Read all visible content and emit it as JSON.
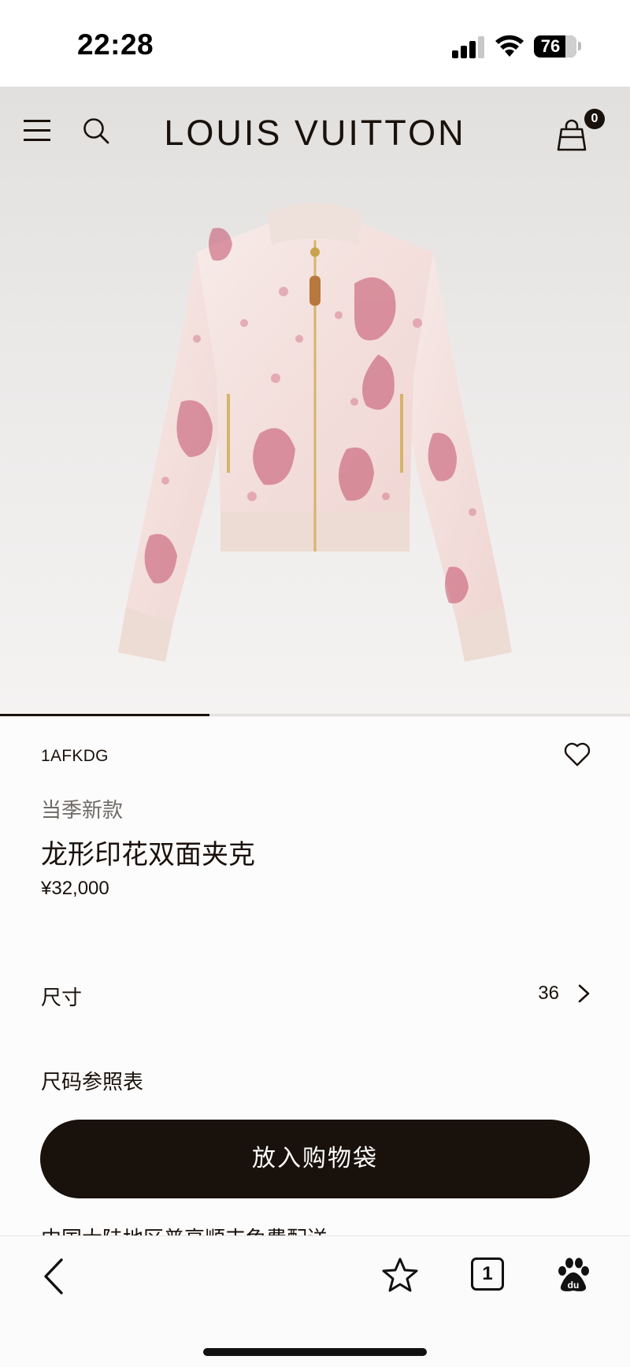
{
  "status_bar": {
    "time": "22:28",
    "battery": "76"
  },
  "header": {
    "brand": "LOUIS VUITTON",
    "bag_count": "0",
    "icons": [
      "menu-icon",
      "search-icon",
      "shopping-bag-icon"
    ]
  },
  "gallery": {
    "image_description_icon": "jacket-image",
    "progress_fraction": 0.333
  },
  "product": {
    "sku": "1AFKDG",
    "tagline": "当季新款",
    "title": "龙形印花双面夹克",
    "price": "¥32,000",
    "size_label": "尺寸",
    "size_value": "36",
    "size_chart": "尺码参照表",
    "add_to_bag": "放入购物袋",
    "delivery_note": "中国大陆地区普享顺丰免费配送"
  },
  "browser_bar": {
    "tab_count": "1",
    "icons": [
      "back-icon",
      "star-icon",
      "tabs-icon",
      "baidu-icon"
    ]
  },
  "colors": {
    "brand_dark": "#19110b",
    "hero_bg": "#ebe9e8"
  }
}
